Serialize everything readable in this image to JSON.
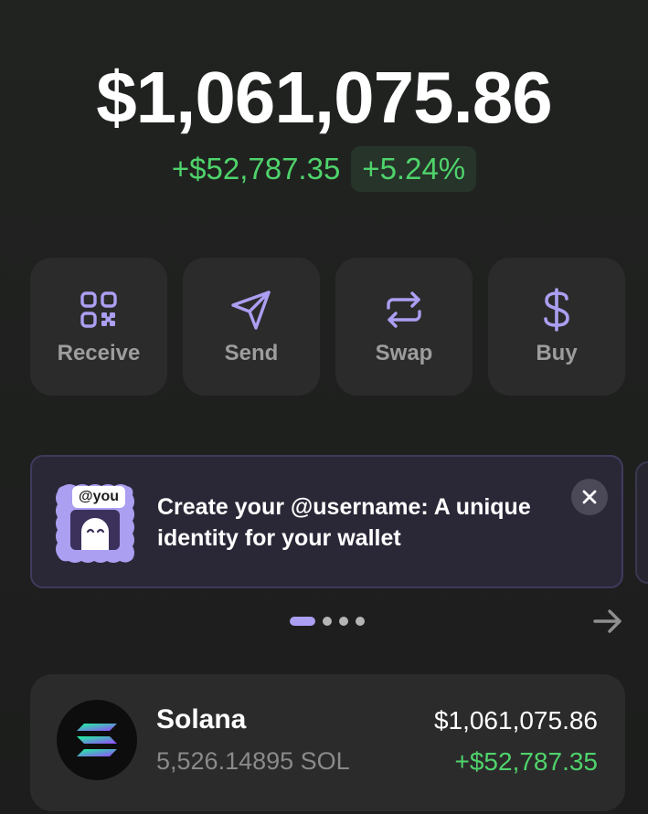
{
  "portfolio": {
    "balance": "$1,061,075.86",
    "change_amount": "+$52,787.35",
    "change_percent": "+5.24%"
  },
  "actions": [
    {
      "label": "Receive",
      "icon": "qr-code-icon"
    },
    {
      "label": "Send",
      "icon": "send-icon"
    },
    {
      "label": "Swap",
      "icon": "swap-icon"
    },
    {
      "label": "Buy",
      "icon": "dollar-icon"
    }
  ],
  "banner": {
    "badge_text": "@you",
    "text": "Create your @username: A unique identity for your wallet",
    "icon": "ghost-mascot-icon",
    "close_icon": "close-icon"
  },
  "carousel": {
    "total_pages": 4,
    "active_page": 1
  },
  "tokens": [
    {
      "name": "Solana",
      "quantity": "5,526.14895 SOL",
      "value": "$1,061,075.86",
      "change": "+$52,787.35",
      "icon": "solana-logo-icon"
    }
  ],
  "colors": {
    "accent": "#ab9ff2",
    "positive": "#4fd36b",
    "card": "#2b2b2b",
    "banner_bg": "#2a2837"
  }
}
